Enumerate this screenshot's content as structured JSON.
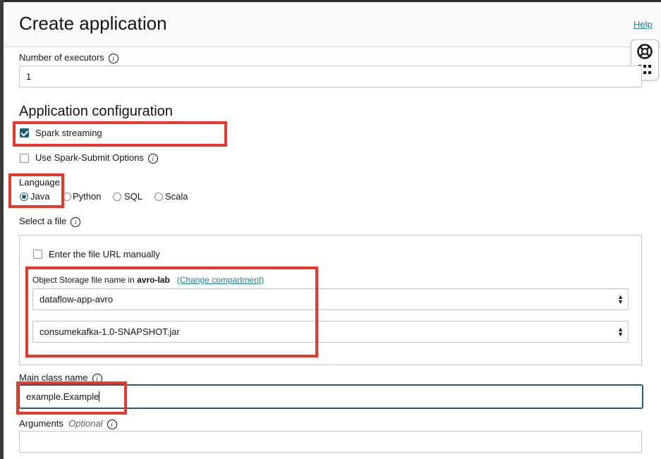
{
  "header": {
    "title": "Create application",
    "help_label": "Help"
  },
  "side_tool": {
    "top_icon": "lifebuoy-icon",
    "bottom_icon": "grid-icon"
  },
  "executors": {
    "label": "Number of executors",
    "value": "1"
  },
  "app_config": {
    "title": "Application configuration",
    "spark_streaming": {
      "label": "Spark streaming",
      "checked": true
    },
    "spark_submit": {
      "label": "Use Spark-Submit Options",
      "checked": false
    }
  },
  "language": {
    "label": "Language",
    "options": [
      {
        "label": "Java",
        "selected": true
      },
      {
        "label": "Python",
        "selected": false
      },
      {
        "label": "SQL",
        "selected": false
      },
      {
        "label": "Scala",
        "selected": false
      }
    ]
  },
  "file": {
    "label": "Select a file",
    "manual_url_label": "Enter the file URL manually",
    "storage_label_prefix": "Object Storage file name in",
    "compartment": "avro-lab",
    "change_compartment": "(Change compartment)",
    "bucket": "dataflow-app-avro",
    "jar": "consumekafka-1.0-SNAPSHOT.jar"
  },
  "main_class": {
    "label": "Main class name",
    "value": "example.Example"
  },
  "arguments": {
    "label": "Arguments",
    "optional": "Optional",
    "value": ""
  },
  "colors": {
    "accent": "#1f5f7b",
    "link": "#227e9e",
    "highlight": "#e8372b"
  }
}
